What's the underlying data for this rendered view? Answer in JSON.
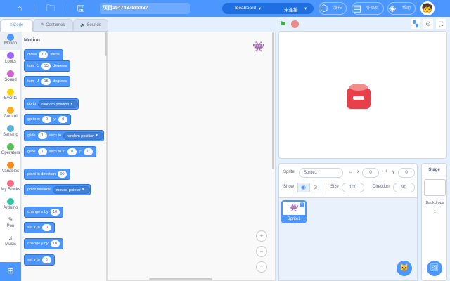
{
  "topbar": {
    "project_title": "项目1547437588837",
    "board": "IdeaBoard",
    "connection": "未连接",
    "publish": "发布",
    "works": "作品页",
    "help": "帮助"
  },
  "tabs": {
    "code": "Code",
    "costumes": "Costumes",
    "sounds": "Sounds"
  },
  "categories": [
    {
      "label": "Motion",
      "color": "#4c97ff"
    },
    {
      "label": "Looks",
      "color": "#9966ff"
    },
    {
      "label": "Sound",
      "color": "#cf63cf"
    },
    {
      "label": "Events",
      "color": "#ffd500"
    },
    {
      "label": "Control",
      "color": "#ffab19"
    },
    {
      "label": "Sensing",
      "color": "#5cb1d6"
    },
    {
      "label": "Operators",
      "color": "#59c059"
    },
    {
      "label": "Variables",
      "color": "#ff8c1a"
    },
    {
      "label": "My Blocks",
      "color": "#ff6680"
    },
    {
      "label": "Arduino",
      "color": "#2ec4a5"
    },
    {
      "label": "Pen",
      "color": ""
    },
    {
      "label": "Music",
      "color": ""
    }
  ],
  "palette": {
    "heading": "Motion",
    "blocks": {
      "move": {
        "a": "move",
        "v": "10",
        "b": "steps"
      },
      "turn_cw": {
        "a": "turn",
        "v": "15",
        "b": "degrees"
      },
      "turn_ccw": {
        "a": "turn",
        "v": "15",
        "b": "degrees"
      },
      "goto": {
        "a": "go to",
        "d": "random position"
      },
      "gotoxy": {
        "a": "go to x:",
        "x": "0",
        "b": "y:",
        "y": "0"
      },
      "glide_to": {
        "a": "glide",
        "v": "1",
        "b": "secs to",
        "d": "random position"
      },
      "glide_xy": {
        "a": "glide",
        "v": "1",
        "b": "secs to x:",
        "x": "0",
        "c": "y:",
        "y": "0"
      },
      "point_dir": {
        "a": "point in direction",
        "v": "90"
      },
      "point_towards": {
        "a": "point towards",
        "d": "mouse-pointer"
      },
      "change_x": {
        "a": "change x by",
        "v": "10"
      },
      "set_x": {
        "a": "set x to",
        "v": "0"
      },
      "change_y": {
        "a": "change y by",
        "v": "10"
      },
      "set_y": {
        "a": "set y to",
        "v": "0"
      }
    }
  },
  "sprite_info": {
    "sprite_label": "Sprite",
    "sprite_name": "Sprite1",
    "x_label": "x",
    "x": "0",
    "y_label": "y",
    "y": "0",
    "show_label": "Show",
    "size_label": "Size",
    "size": "100",
    "direction_label": "Direction",
    "direction": "90"
  },
  "sprites": [
    {
      "name": "Sprite1"
    }
  ],
  "stage_panel": {
    "title": "Stage",
    "backdrops_label": "Backdrops",
    "backdrops_count": "1"
  }
}
